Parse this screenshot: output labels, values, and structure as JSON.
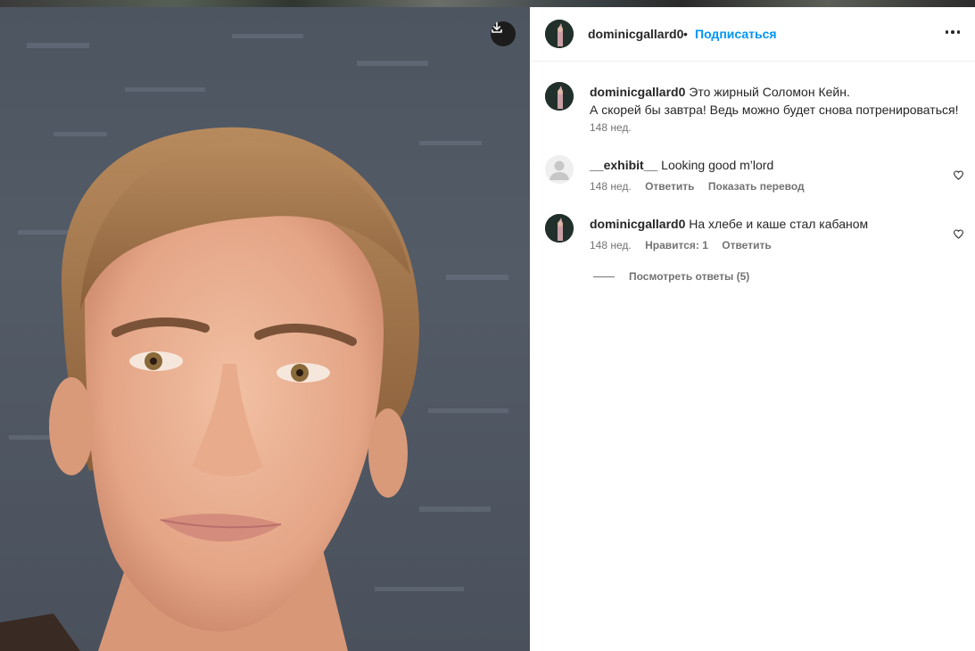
{
  "post": {
    "author": "dominicgallard0",
    "separator": "•",
    "follow_label": "Подписаться"
  },
  "comments": [
    {
      "user": "dominicgallard0",
      "text_line1": "Это жирный Соломон Кейн.",
      "text_line2": "А скорей бы завтра! Ведь можно будет снова потренироваться!",
      "time": "148 нед."
    },
    {
      "user": "__exhibit__",
      "text": "Looking good m’lord",
      "time": "148 нед.",
      "reply_label": "Ответить",
      "translate_label": "Показать перевод"
    },
    {
      "user": "dominicgallard0",
      "text": "На хлебе и каше стал кабаном",
      "time": "148 нед.",
      "likes_label": "Нравится: 1",
      "reply_label": "Ответить",
      "view_replies": "Посмотреть ответы (5)"
    }
  ],
  "icons": {
    "download": "download-icon",
    "more": "more-horizontal-icon",
    "heart": "heart-outline-icon",
    "default_avatar": "default-avatar-icon"
  },
  "colors": {
    "accent": "#0095f6",
    "secondary_text": "#737373",
    "primary_text": "#262626"
  }
}
